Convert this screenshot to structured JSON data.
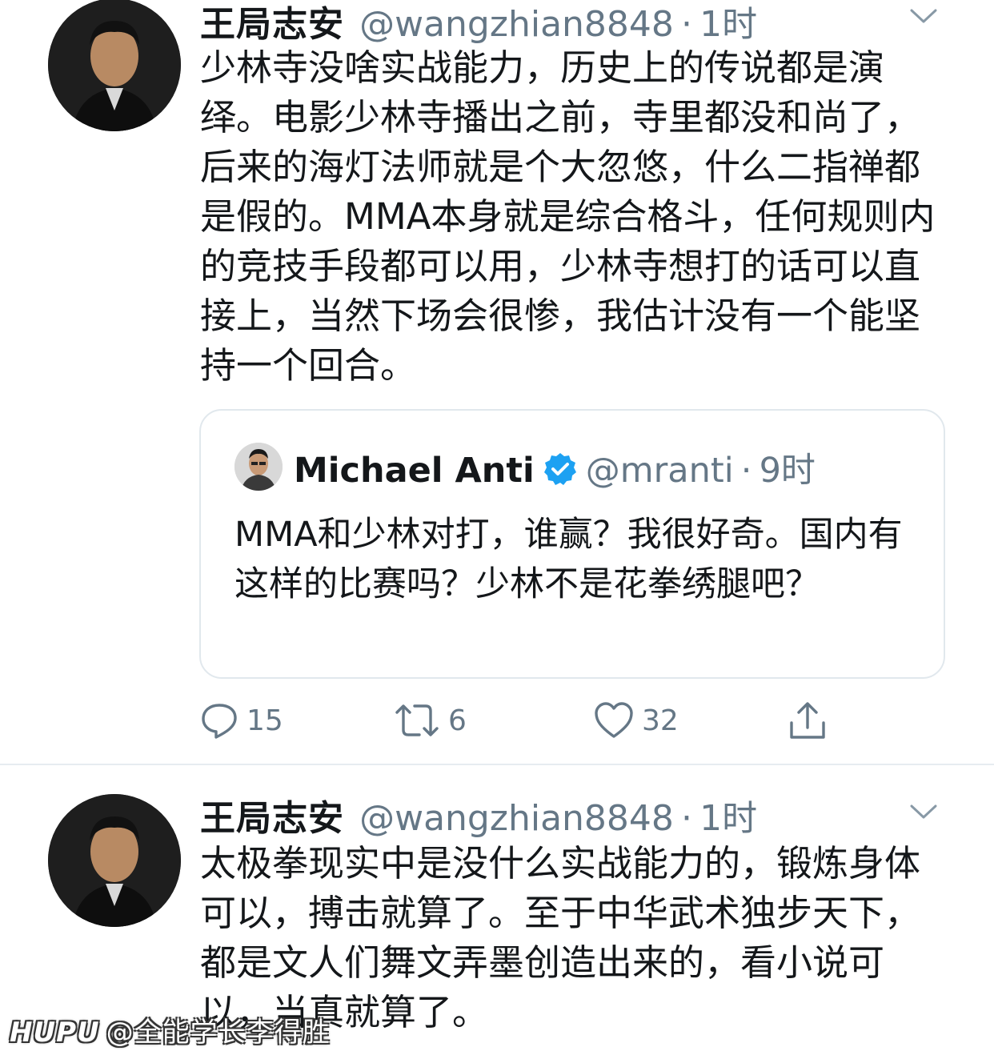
{
  "tweets": [
    {
      "display_name": "王局志安",
      "handle": "@wangzhian8848",
      "separator": "·",
      "time": "1时",
      "text": "少林寺没啥实战能力，历史上的传说都是演绎。电影少林寺播出之前，寺里都没和尚了，后来的海灯法师就是个大忽悠，什么二指禅都是假的。MMA本身就是综合格斗，任何规则内的竞技手段都可以用，少林寺想打的话可以直接上，当然下场会很惨，我估计没有一个能坚持一个回合。",
      "quoted": {
        "display_name": "Michael Anti",
        "verified": true,
        "handle": "@mranti",
        "separator": "·",
        "time": "9时",
        "text": "MMA和少林对打，谁赢？我很好奇。国内有这样的比赛吗？少林不是花拳绣腿吧？"
      },
      "actions": {
        "reply_count": "15",
        "retweet_count": "6",
        "like_count": "32"
      }
    },
    {
      "display_name": "王局志安",
      "handle": "@wangzhian8848",
      "separator": "·",
      "time": "1时",
      "text": "太极拳现实中是没什么实战能力的，锻炼身体可以，搏击就算了。至于中华武术独步天下，都是文人们舞文弄墨创造出来的，看小说可以，当真就算了。"
    }
  ],
  "watermark": {
    "brand": "HUPU",
    "user": "@全能学长李得胜"
  },
  "colors": {
    "text": "#14171a",
    "secondary": "#657786",
    "verified": "#1da1f2",
    "border": "#e1e8ed"
  },
  "icons": [
    "avatar-image",
    "chevron-down-icon",
    "verified-badge-icon",
    "reply-icon",
    "retweet-icon",
    "like-icon",
    "share-icon"
  ]
}
